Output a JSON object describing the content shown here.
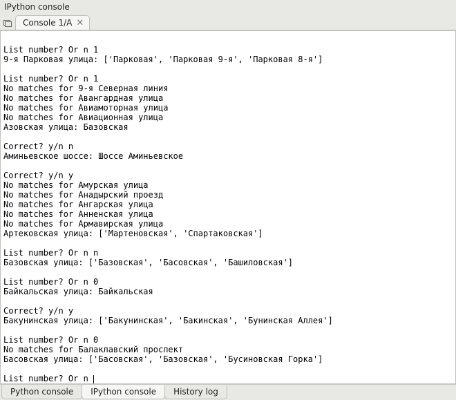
{
  "window": {
    "title": "IPython console"
  },
  "tabs": {
    "top": [
      {
        "label": "Console 1/A"
      }
    ]
  },
  "bottom_tabs": [
    {
      "label": "Python console",
      "active": false
    },
    {
      "label": "IPython console",
      "active": true
    },
    {
      "label": "History log",
      "active": false
    }
  ],
  "console_lines": [
    "",
    "List number? Or n 1",
    "9-я Парковая улица: ['Парковая', 'Парковая 9-я', 'Парковая 8-я']",
    "",
    "List number? Or n 1",
    "No matches for 9-я Северная линия",
    "No matches for Авангардная улица",
    "No matches for Авиамоторная улица",
    "No matches for Авиационная улица",
    "Азовская улица: Базовская",
    "",
    "Correct? y/n n",
    "Аминьевское шоссе: Шоссе Аминьевское",
    "",
    "Correct? y/n y",
    "No matches for Амурская улица",
    "No matches for Анадырский проезд",
    "No matches for Ангарская улица",
    "No matches for Анненская улица",
    "No matches for Армавирская улица",
    "Артековская улица: ['Мартеновская', 'Спартаковская']",
    "",
    "List number? Or n n",
    "Базовская улица: ['Базовская', 'Басовская', 'Башиловская']",
    "",
    "List number? Or n 0",
    "Байкальская улица: Байкальская",
    "",
    "Correct? y/n y",
    "Бакунинская улица: ['Бакунинская', 'Бакинская', 'Бунинская Аллея']",
    "",
    "List number? Or n 0",
    "No matches for Балаклавский проспект",
    "Басовская улица: ['Басовская', 'Базовская', 'Бусиновская Горка']",
    ""
  ],
  "prompt_line": "List number? Or n "
}
